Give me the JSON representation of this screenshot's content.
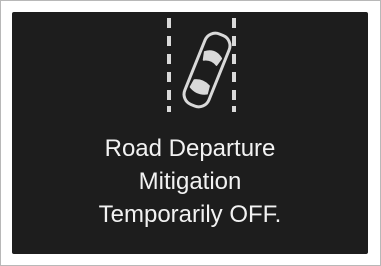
{
  "warning": {
    "icon": "road-departure-car-icon",
    "lines": [
      "Road Departure",
      "Mitigation",
      "Temporarily OFF."
    ]
  },
  "colors": {
    "screen_background": "#1d1d1d",
    "text": "#f2f2f2",
    "icon_stroke": "#d9d9d9",
    "page_background": "#ffffff"
  }
}
